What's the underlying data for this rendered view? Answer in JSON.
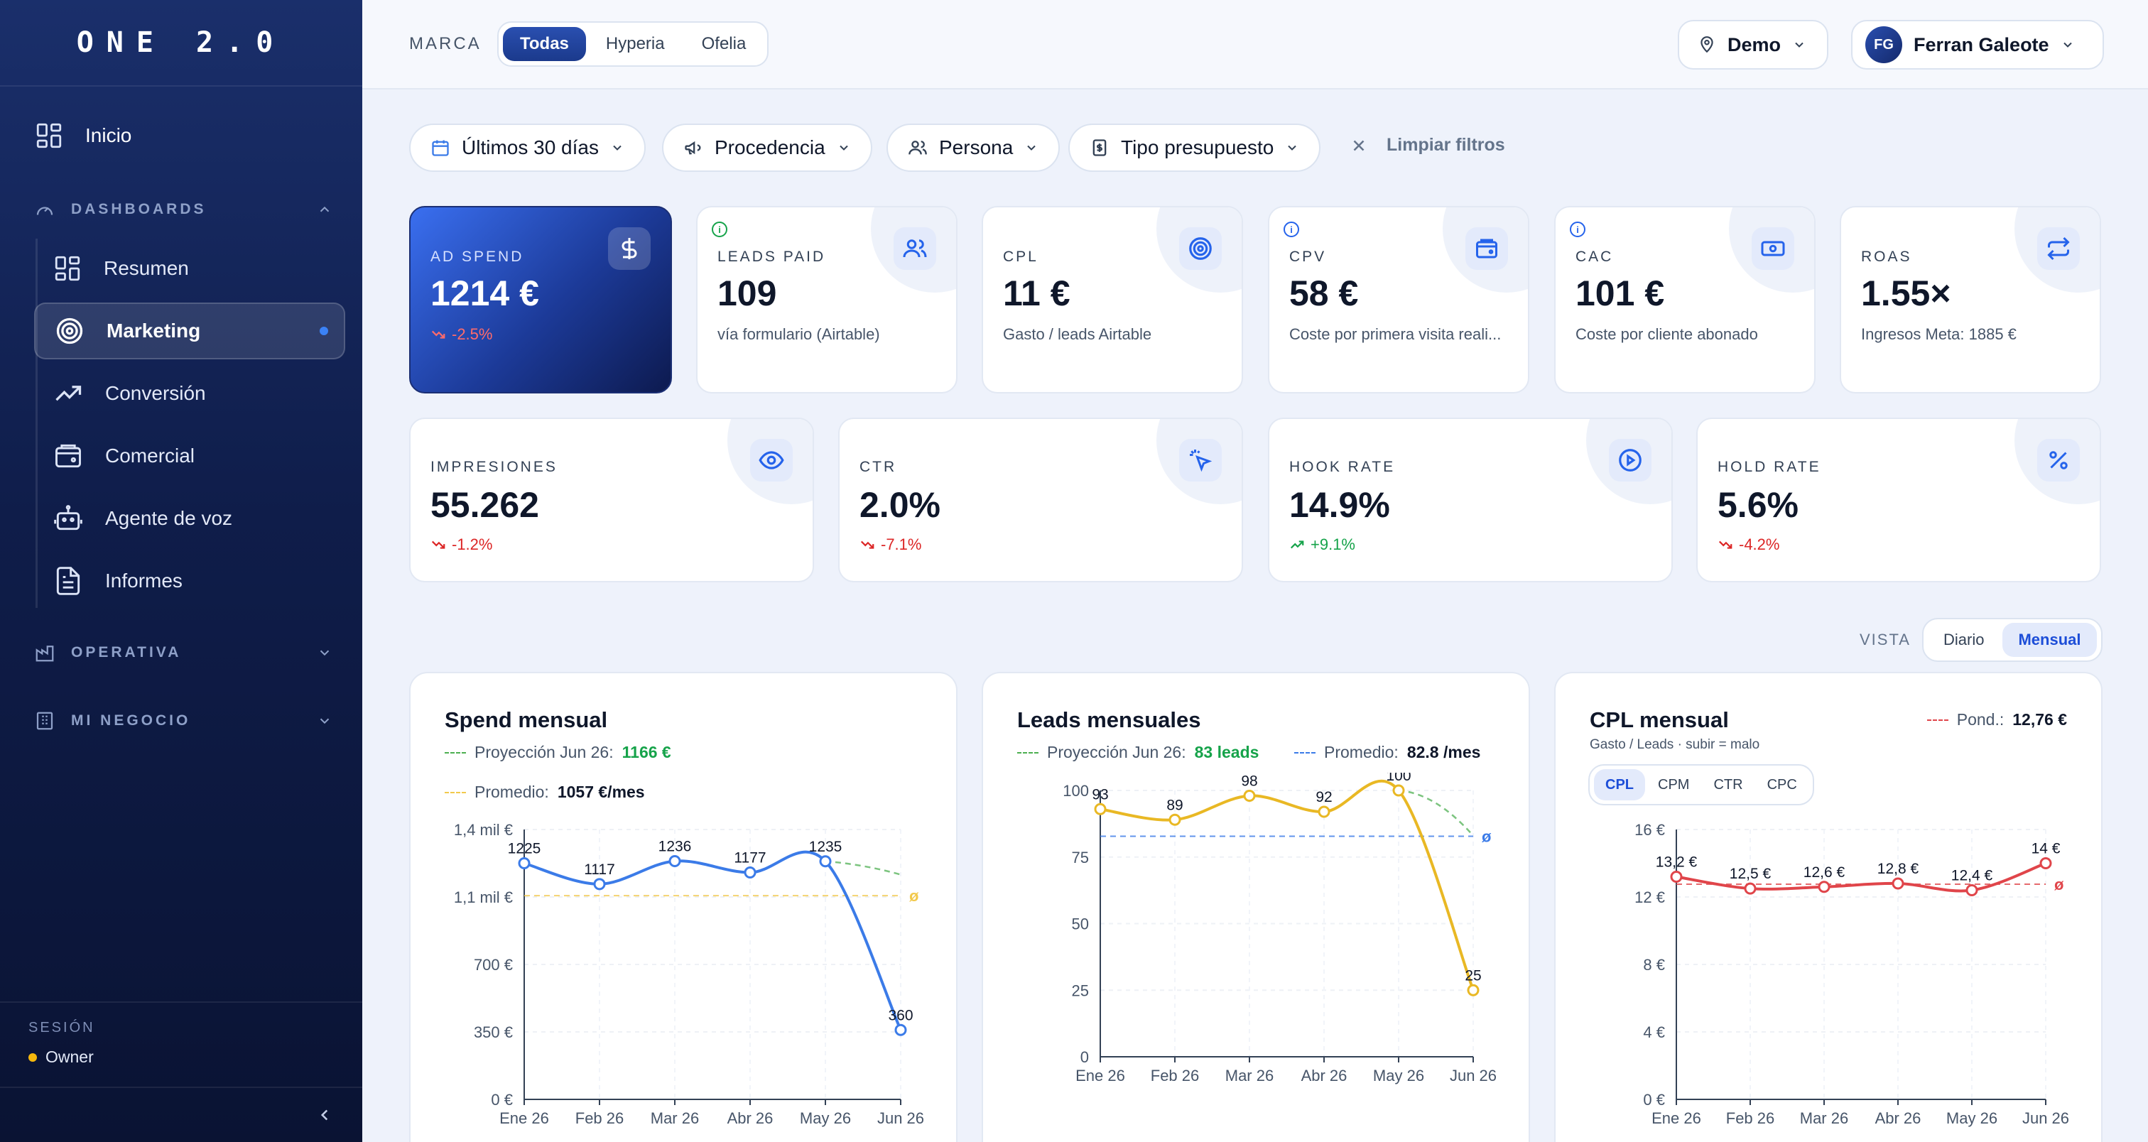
{
  "sidebar": {
    "logo": "ONE 2.0",
    "home": "Inicio",
    "sections": {
      "dashboards": "DASHBOARDS",
      "operativa": "OPERATIVA",
      "negocio": "MI NEGOCIO"
    },
    "items": [
      "Resumen",
      "Marketing",
      "Conversión",
      "Comercial",
      "Agente de voz",
      "Informes"
    ],
    "active": "Marketing",
    "session_label": "SESIÓN",
    "session_role": "Owner"
  },
  "topbar": {
    "marca_label": "MARCA",
    "brands": [
      "Todas",
      "Hyperia",
      "Ofelia"
    ],
    "selected_brand": "Todas",
    "workspace": "Demo",
    "user_initials": "FG",
    "user_name": "Ferran Galeote"
  },
  "filters": {
    "date": "Últimos 30 días",
    "source": "Procedencia",
    "persona": "Persona",
    "budget": "Tipo presupuesto",
    "clear": "Limpiar filtros"
  },
  "kpis_row1": [
    {
      "label": "AD SPEND",
      "value": "1214 €",
      "sub": "-2.5%",
      "icon": "dollar-icon"
    },
    {
      "label": "LEADS PAID",
      "value": "109",
      "sub": "vía formulario (Airtable)",
      "icon": "users-icon"
    },
    {
      "label": "CPL",
      "value": "11 €",
      "sub": "Gasto / leads Airtable",
      "icon": "target-icon"
    },
    {
      "label": "CPV",
      "value": "58 €",
      "sub": "Coste por primera visita reali...",
      "icon": "wallet-icon"
    },
    {
      "label": "CAC",
      "value": "101 €",
      "sub": "Coste por cliente abonado",
      "icon": "banknote-icon"
    },
    {
      "label": "ROAS",
      "value": "1.55×",
      "sub": "Ingresos Meta: 1885 €",
      "icon": "repeat-icon"
    }
  ],
  "kpis_row2": [
    {
      "label": "IMPRESIONES",
      "value": "55.262",
      "delta": "-1.2%",
      "trend": "down",
      "icon": "eye-icon"
    },
    {
      "label": "CTR",
      "value": "2.0%",
      "delta": "-7.1%",
      "trend": "down",
      "icon": "pointer-icon"
    },
    {
      "label": "HOOK RATE",
      "value": "14.9%",
      "delta": "+9.1%",
      "trend": "up",
      "icon": "play-icon"
    },
    {
      "label": "HOLD RATE",
      "value": "5.6%",
      "delta": "-4.2%",
      "trend": "down",
      "icon": "percent-icon"
    }
  ],
  "vista": {
    "label": "VISTA",
    "options": [
      "Diario",
      "Mensual"
    ],
    "selected": "Mensual"
  },
  "charts": {
    "spend": {
      "title": "Spend mensual",
      "proj_label": "Proyección Jun 26:",
      "proj_value": "1166 €",
      "avg_label": "Promedio:",
      "avg_value": "1057 €/mes"
    },
    "leads": {
      "title": "Leads mensuales",
      "proj_label": "Proyección Jun 26:",
      "proj_value": "83 leads",
      "avg_label": "Promedio:",
      "avg_value": "82.8 /mes"
    },
    "cpl": {
      "title": "CPL mensual",
      "subtitle": "Gasto / Leads · subir = malo",
      "pond_label": "Pond.:",
      "pond_value": "12,76 €",
      "metrics": [
        "CPL",
        "CPM",
        "CTR",
        "CPC"
      ],
      "selected_metric": "CPL"
    }
  },
  "chart_data": [
    {
      "type": "line",
      "title": "Spend mensual",
      "x": [
        "Ene 26",
        "Feb 26",
        "Mar 26",
        "Abr 26",
        "May 26",
        "Jun 26"
      ],
      "series": [
        {
          "values": [
            1225,
            1117,
            1236,
            1177,
            1235,
            360
          ]
        }
      ],
      "value_labels": [
        "1225",
        "1117",
        "1236",
        "1177",
        "1235",
        "360"
      ],
      "projection": 1166,
      "average": 1057,
      "avg_marker": "ø",
      "yticks": [
        0,
        350,
        700,
        1050,
        1400
      ],
      "ytick_labels": [
        "0 €",
        "350 €",
        "700 €",
        "1,1 mil €",
        "1,4 mil €"
      ],
      "ylim": [
        0,
        1400
      ],
      "color": "#3b7be8"
    },
    {
      "type": "line",
      "title": "Leads mensuales",
      "x": [
        "Ene 26",
        "Feb 26",
        "Mar 26",
        "Abr 26",
        "May 26",
        "Jun 26"
      ],
      "series": [
        {
          "values": [
            93,
            89,
            98,
            92,
            100,
            25
          ]
        }
      ],
      "value_labels": [
        "93",
        "89",
        "98",
        "92",
        "100",
        "25"
      ],
      "projection": 83,
      "average": 82.8,
      "avg_marker": "ø",
      "yticks": [
        0,
        25,
        50,
        75,
        100
      ],
      "ytick_labels": [
        "0",
        "25",
        "50",
        "75",
        "100"
      ],
      "ylim": [
        0,
        100
      ],
      "color": "#e9b824"
    },
    {
      "type": "line",
      "title": "CPL mensual",
      "x": [
        "Ene 26",
        "Feb 26",
        "Mar 26",
        "Abr 26",
        "May 26",
        "Jun 26"
      ],
      "series": [
        {
          "values": [
            13.2,
            12.5,
            12.6,
            12.8,
            12.4,
            14
          ]
        }
      ],
      "value_labels": [
        "13,2 €",
        "12,5 €",
        "12,6 €",
        "12,8 €",
        "12,4 €",
        "14 €"
      ],
      "average": 12.76,
      "avg_marker": "ø",
      "yticks": [
        0,
        4,
        8,
        12,
        16
      ],
      "ytick_labels": [
        "0 €",
        "4 €",
        "8 €",
        "12 €",
        "16 €"
      ],
      "ylim": [
        0,
        16
      ],
      "color": "#e0454a"
    }
  ]
}
